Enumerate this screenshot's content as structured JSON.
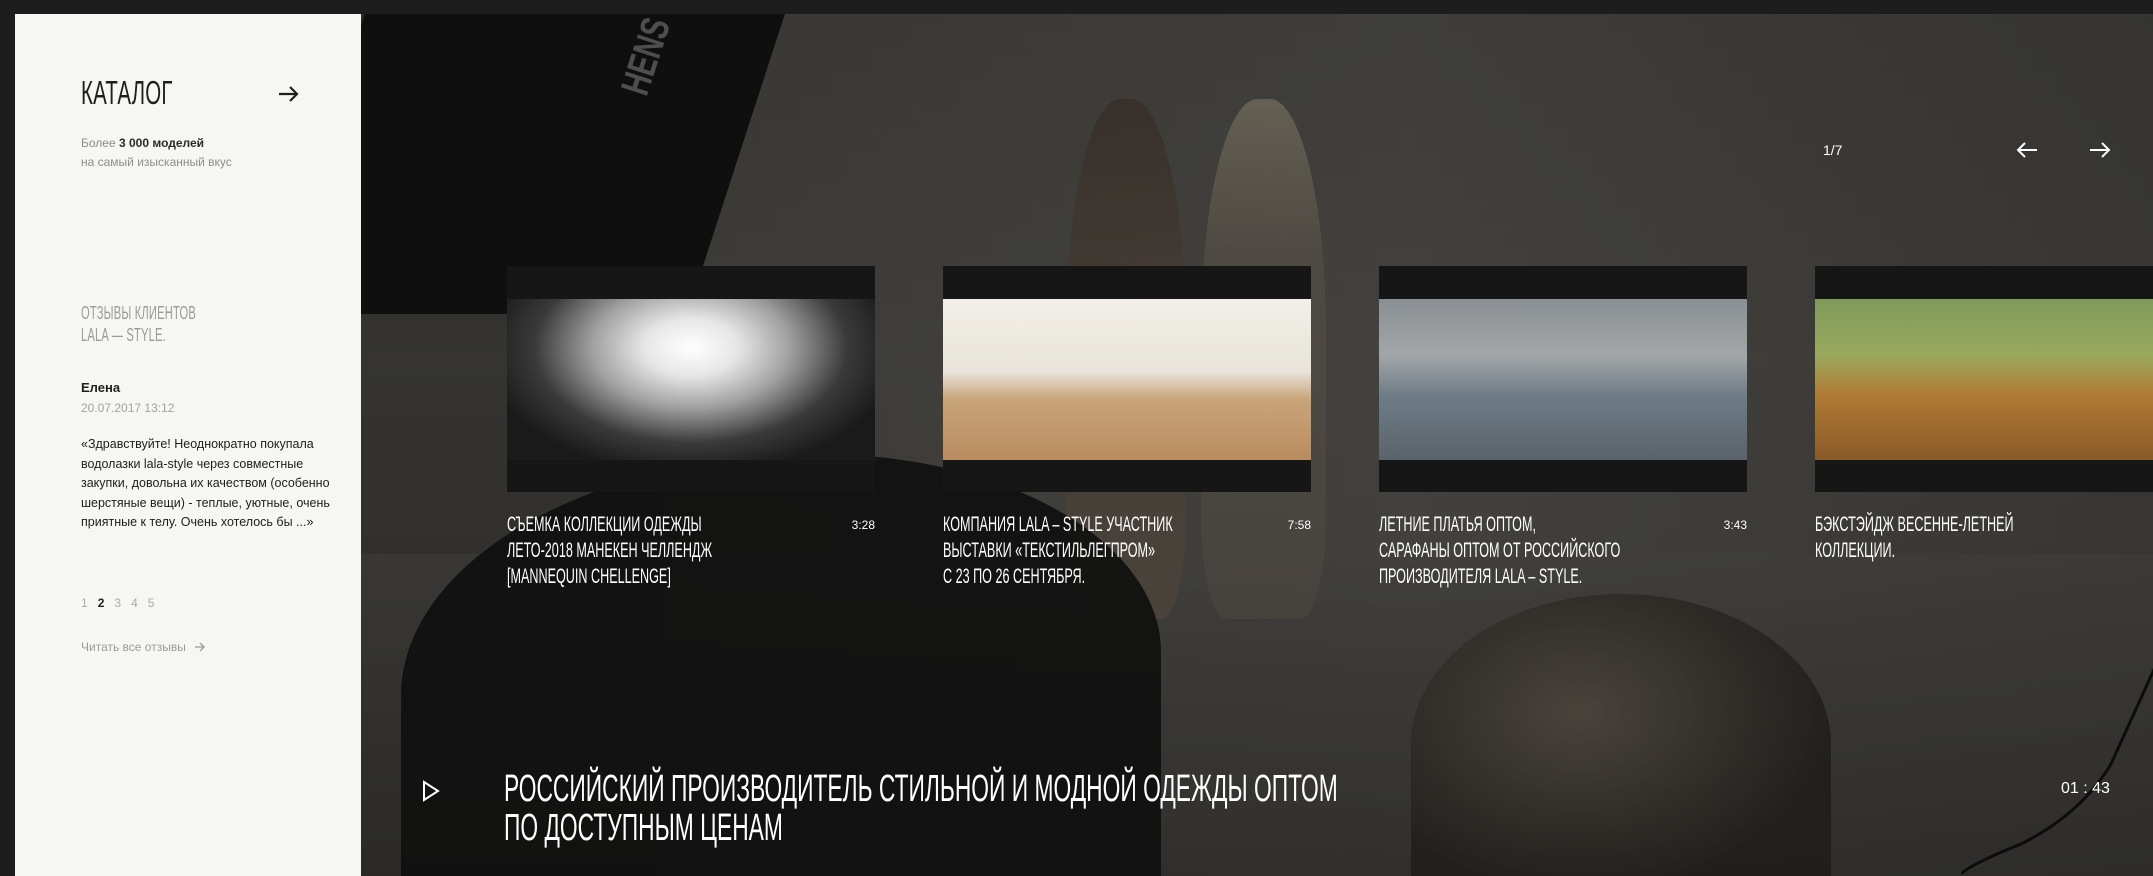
{
  "sidebar": {
    "catalog_title": "КАТАЛОГ",
    "catalog_prefix": "Более",
    "catalog_count": "3 000 моделей",
    "catalog_tagline": "на самый изысканный вкус",
    "reviews_heading_line1": "ОТЗЫВЫ КЛИЕНТОВ",
    "reviews_heading_line2": "LALA — STYLE.",
    "review": {
      "name": "Елена",
      "date": "20.07.2017 13:12",
      "text": "«Здравствуйте! Неоднократно покупала водолазки lala-style через совместные закупки, довольна их качеством (особенно шерстяные вещи) - теплые, уютные, очень приятные к телу. Очень хотелось бы ...»"
    },
    "pages": [
      "1",
      "2",
      "3",
      "4",
      "5"
    ],
    "active_page": "2",
    "all_reviews_label": "Читать все отзывы"
  },
  "slider": {
    "counter": "1/7",
    "videos": [
      {
        "title": "СЪЕМКА КОЛЛЕКЦИИ ОДЕЖДЫ\nЛЕТО-2018 МАНЕКЕН ЧЕЛЛЕНДЖ\n[MANNEQUIN CHELLENGE]",
        "duration": "3:28"
      },
      {
        "title": "КОМПАНИЯ LALA – STYLE УЧАСТНИК\nВЫСТАВКИ «ТЕКСТИЛЬЛЕГПРОМ»\nС 23 ПО 26 СЕНТЯБРЯ.",
        "duration": "7:58"
      },
      {
        "title": "ЛЕТНИЕ ПЛАТЬЯ ОПТОМ,\nСАРАФАНЫ ОПТОМ ОТ РОССИЙСКОГО\nПРОИЗВОДИТЕЛЯ LALA – STYLE.",
        "duration": "3:43"
      },
      {
        "title": "БЭКСТЭЙДЖ ВЕСЕННЕ-ЛЕТНЕЙ\nКОЛЛЕКЦИИ.",
        "duration": ""
      }
    ]
  },
  "hero": {
    "softbox_label": "HENS",
    "title": "РОССИЙСКИЙ ПРОИЗВОДИТЕЛЬ СТИЛЬНОЙ И МОДНОЙ ОДЕЖДЫ ОПТОМ\nПО ДОСТУПНЫМ ЦЕНАМ",
    "time": "01 : 43"
  },
  "icons": {
    "catalog": "arrow-right-icon",
    "all_reviews": "arrow-right-icon",
    "prev": "arrow-left-icon",
    "next": "arrow-right-icon",
    "play": "play-icon"
  },
  "colors": {
    "sidebar_bg": "#f6f6f2",
    "page_bg": "#1d1d1d",
    "text_light": "#ffffff"
  }
}
